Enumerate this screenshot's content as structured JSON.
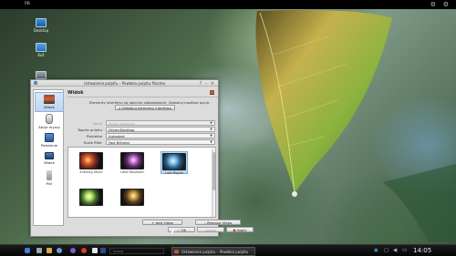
{
  "top_bar": {
    "label": "PB"
  },
  "desktop": {
    "icons": [
      {
        "label": "Desktop"
      },
      {
        "label": "Koš"
      },
      {
        "label": "Dysk"
      }
    ]
  },
  "window": {
    "title": "Ustawienia pulpitu – Powłoka pulpitu Plazma",
    "sidebar": [
      {
        "label": "Widok",
        "icon": "desktop-icon",
        "active": true
      },
      {
        "label": "Akcje myszy",
        "icon": "mouse-icon"
      },
      {
        "label": "Położenie",
        "icon": "position-icon"
      },
      {
        "label": "Widok",
        "icon": "monitor-icon"
      },
      {
        "label": "Filtr",
        "icon": "filter-icon"
      }
    ],
    "header": "Widok",
    "locked_notice": "Elementy interfejsu są obecnie zablokowane. Zablokuj możliwe opcje.",
    "unlock_button": "Odblokuj elementy interfejsu",
    "rows": [
      {
        "label": "Układ",
        "value": "Widok katalogu",
        "disabled": true
      },
      {
        "label": "Tapeta pulpitu",
        "value": "DreamDesktop"
      },
      {
        "label": "Plakietka",
        "value": "Autostart"
      },
      {
        "label": "Scale filter",
        "value": "Fast Bilinear"
      }
    ],
    "wallpapers": [
      {
        "name": "Evening Shine"
      },
      {
        "name": "Lake Mountain"
      },
      {
        "name": "Leaf Ripple",
        "selected": true
      },
      {
        "name": ""
      },
      {
        "name": ""
      }
    ],
    "buttons": {
      "add": "Add Video",
      "remove": "Remove Video",
      "ok": "OK",
      "cancel": "Anuluj",
      "apply": "Apply"
    }
  },
  "taskbar": {
    "search_placeholder": "Szukaj",
    "task": "Ustawienia pulpitu – Powłoka pulpitu",
    "clock": "14:05"
  }
}
